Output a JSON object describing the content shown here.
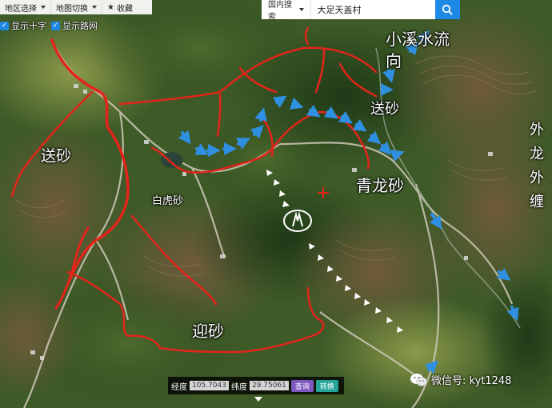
{
  "toolbar": {
    "region_select": "地区选择",
    "map_switch": "地图切换",
    "favorite": "收藏"
  },
  "layers": {
    "show_cross": "显示十字",
    "show_roads": "显示路网"
  },
  "search": {
    "scope": "国内搜索",
    "value": "大足天盖村"
  },
  "coords": {
    "lng_label": "经度",
    "lng_value": "105.7043",
    "lat_label": "纬度",
    "lat_value": "29.75061",
    "query_button": "查询",
    "convert_button": "转换"
  },
  "labels": {
    "stream_line1": "小溪水流",
    "stream_line2": "向",
    "send_sand_right": "送砂",
    "send_sand_left": "送砂",
    "green_dragon_sand": "青龙砂",
    "white_tiger_sand": "白虎砂",
    "welcome_sand": "迎砂",
    "outer_dragon": "外龙外缠"
  },
  "watermark": {
    "text": "微信号: kyt1248",
    "icon": "wechat-icon"
  },
  "colors": {
    "ridge_line": "#e3241b",
    "water_flow": "#2f8fe0",
    "white_arrows": "#ffffff",
    "search_button": "#1e88e5",
    "query_button": "#7e57c2",
    "convert_button": "#26a69a"
  }
}
